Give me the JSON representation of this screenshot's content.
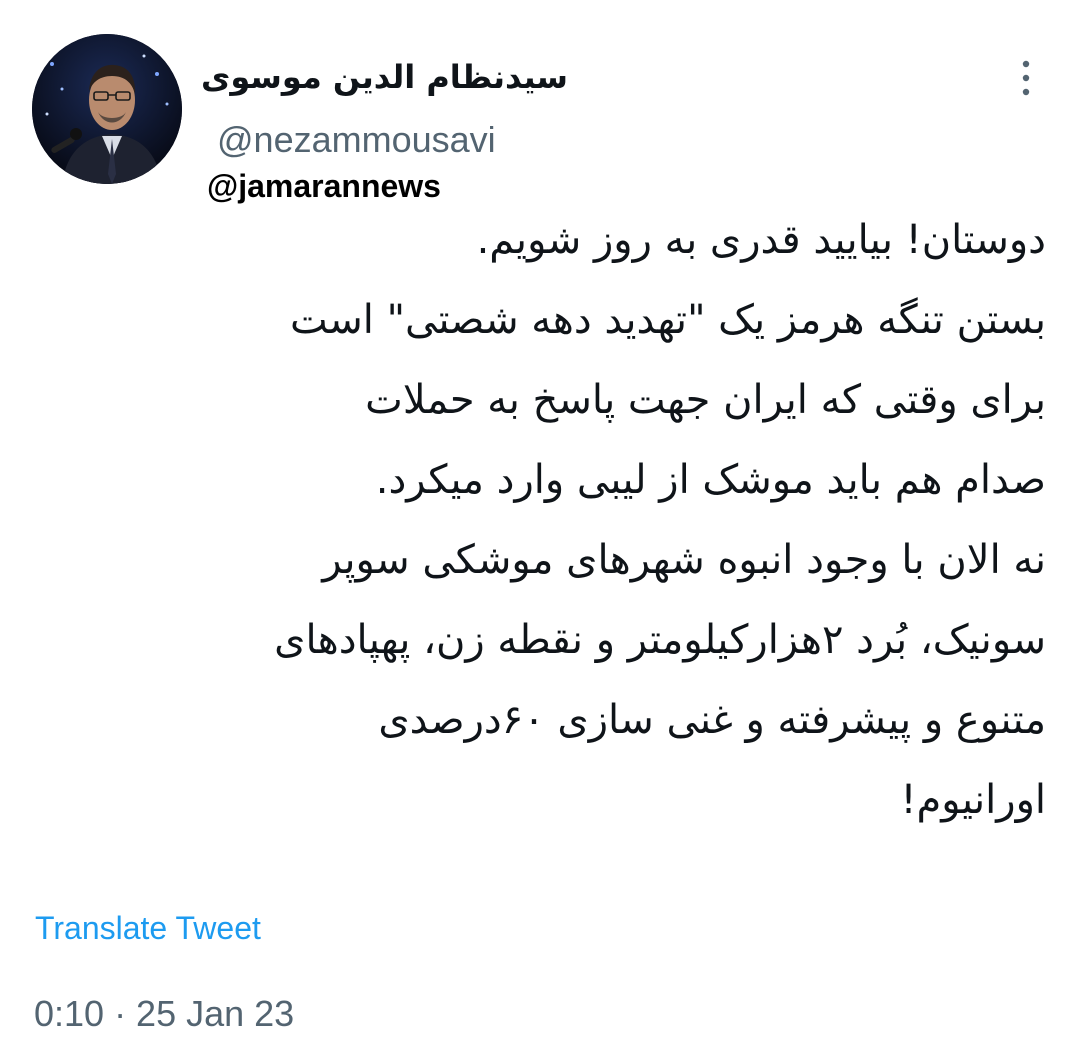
{
  "author": {
    "display_name": "سیدنظام الدین موسوی",
    "handle": "@nezammousavi"
  },
  "watermark": "@jamarannews",
  "tweet": {
    "lines": [
      "دوستان! بیایید قدری به روز شویم.",
      "بستن تنگه هرمز یک \"تهدید دهه شصتی\" است",
      "برای وقتی که ایران جهت پاسخ به حملات",
      "صدام هم باید موشک از لیبی وارد میکرد.",
      "نه الان با وجود انبوه شهرهای موشکی سوپر",
      "سونیک، بُرد ۲هزارکیلومتر و نقطه زن، پهپادهای",
      "متنوع و پیشرفته و غنی سازی ۶۰درصدی",
      "اورانیوم!"
    ]
  },
  "actions": {
    "translate_label": "Translate Tweet",
    "more_icon": "more-vertical-icon"
  },
  "meta": {
    "timestamp": "0:10 · 25 Jan 23"
  },
  "colors": {
    "text": "#0f1419",
    "secondary": "#536471",
    "link": "#1d9bf0"
  }
}
